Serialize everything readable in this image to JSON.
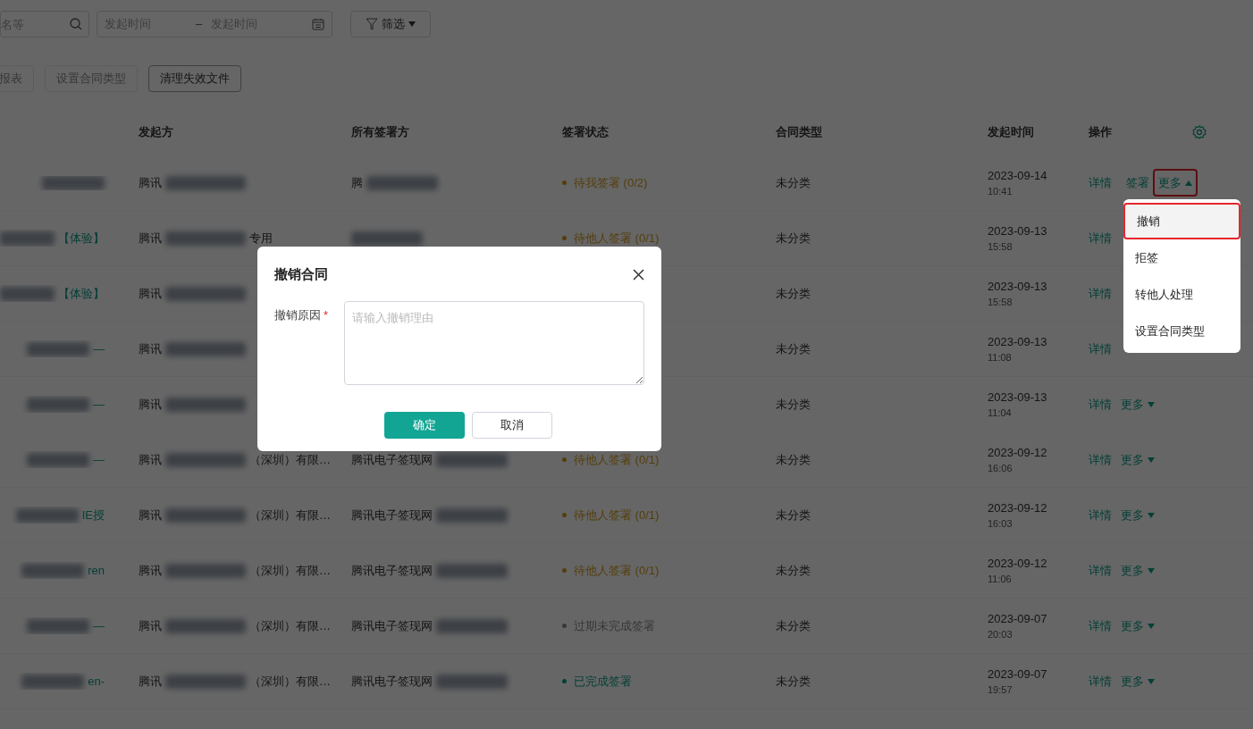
{
  "toolbar": {
    "search": {
      "placeholder": "名等"
    },
    "date_range": {
      "start_placeholder": "发起时间",
      "separator": "–",
      "end_placeholder": "发起时间"
    },
    "filter_button": {
      "label": "筛选"
    }
  },
  "actions": [
    {
      "label": "报表",
      "disabled": true
    },
    {
      "label": "设置合同类型",
      "disabled": true
    },
    {
      "label": "清理失效文件",
      "disabled": false
    }
  ],
  "table": {
    "columns": [
      "发起方",
      "所有签署方",
      "签署状态",
      "合同类型",
      "发起时间",
      "操作"
    ],
    "rows": [
      {
        "initiator": "腾讯",
        "signers": "腾",
        "status": {
          "text": "待我签署 (0/2)",
          "kind": "pending"
        },
        "type": "未分类",
        "date": "2023-09-14",
        "time": "10:41",
        "links": [
          "详情",
          "签署"
        ],
        "more": {
          "label": "更多",
          "expanded": true,
          "highlighted": true
        }
      },
      {
        "name": "【体验】",
        "initiator": "腾讯",
        "initiator_suffix": "专用",
        "status": {
          "text": "待他人签署 (0/1)",
          "kind": "pending"
        },
        "type": "未分类",
        "date": "2023-09-13",
        "time": "15:58",
        "links": [
          "详情"
        ]
      },
      {
        "name": "【体验】",
        "initiator": "腾讯",
        "type": "未分类",
        "date": "2023-09-13",
        "time": "15:58",
        "links": [
          "详情"
        ]
      },
      {
        "name": "—",
        "initiator": "腾讯",
        "type": "未分类",
        "date": "2023-09-13",
        "time": "11:08",
        "links": [
          "详情"
        ]
      },
      {
        "name": "—",
        "initiator": "腾讯",
        "type": "未分类",
        "date": "2023-09-13",
        "time": "11:04",
        "links": [
          "详情"
        ],
        "more": {
          "label": "更多",
          "expanded": false,
          "highlighted": false
        }
      },
      {
        "name": "—",
        "initiator": "腾讯",
        "initiator_suffix": "（深圳）有限…",
        "signers": "腾讯电子签现网",
        "status": {
          "text": "待他人签署 (0/1)",
          "kind": "pending"
        },
        "type": "未分类",
        "date": "2023-09-12",
        "time": "16:06",
        "links": [
          "详情"
        ],
        "more": {
          "label": "更多",
          "expanded": false,
          "highlighted": false
        }
      },
      {
        "name": "IE授",
        "initiator": "腾讯",
        "initiator_suffix": "（深圳）有限…",
        "signers": "腾讯电子签现网",
        "status": {
          "text": "待他人签署 (0/1)",
          "kind": "pending"
        },
        "type": "未分类",
        "date": "2023-09-12",
        "time": "16:03",
        "links": [
          "详情"
        ],
        "more": {
          "label": "更多",
          "expanded": false,
          "highlighted": false
        }
      },
      {
        "name": "ren",
        "initiator": "腾讯",
        "initiator_suffix": "（深圳）有限…",
        "signers": "腾讯电子签现网",
        "status": {
          "text": "待他人签署 (0/1)",
          "kind": "pending"
        },
        "type": "未分类",
        "date": "2023-09-12",
        "time": "11:06",
        "links": [
          "详情"
        ],
        "more": {
          "label": "更多",
          "expanded": false,
          "highlighted": false
        }
      },
      {
        "name": "—",
        "initiator": "腾讯",
        "initiator_suffix": "（深圳）有限…",
        "signers": "腾讯电子签现网",
        "status": {
          "text": "过期未完成签署",
          "kind": "expired"
        },
        "type": "未分类",
        "date": "2023-09-07",
        "time": "20:03",
        "links": [
          "详情"
        ],
        "more": {
          "label": "更多",
          "expanded": false,
          "highlighted": false
        }
      },
      {
        "name": "en-",
        "initiator": "腾讯",
        "initiator_suffix": "（深圳）有限…",
        "signers": "腾讯电子签现网",
        "status": {
          "text": "已完成签署",
          "kind": "done"
        },
        "type": "未分类",
        "date": "2023-09-07",
        "time": "19:57",
        "links": [
          "详情"
        ],
        "more": {
          "label": "更多",
          "expanded": false,
          "highlighted": false
        }
      }
    ]
  },
  "dropdown": {
    "items": [
      {
        "label": "撤销",
        "selected": true,
        "highlighted": true
      },
      {
        "label": "拒签",
        "selected": false,
        "highlighted": false
      },
      {
        "label": "转他人处理",
        "selected": false,
        "highlighted": false
      },
      {
        "label": "设置合同类型",
        "selected": false,
        "highlighted": false
      }
    ]
  },
  "dialog": {
    "title": "撤销合同",
    "field": {
      "label": "撤销原因",
      "required": true,
      "required_mark": "*",
      "placeholder": "请输入撤销理由"
    },
    "buttons": [
      {
        "label": "确定",
        "kind": "primary"
      },
      {
        "label": "取消",
        "kind": "secondary"
      }
    ]
  }
}
